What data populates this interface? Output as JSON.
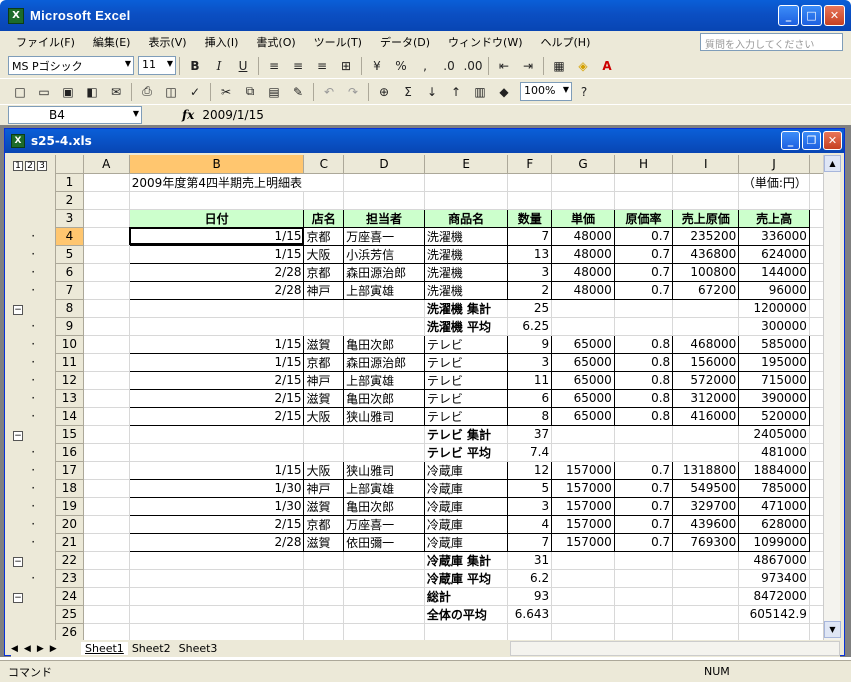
{
  "app": {
    "title": "Microsoft Excel",
    "help_placeholder": "質問を入力してください"
  },
  "menu": [
    "ファイル(F)",
    "編集(E)",
    "表示(V)",
    "挿入(I)",
    "書式(O)",
    "ツール(T)",
    "データ(D)",
    "ウィンドウ(W)",
    "ヘルプ(H)"
  ],
  "toolbar": {
    "font": "MS Pゴシック",
    "size": "11",
    "zoom": "100%"
  },
  "formula": {
    "name": "B4",
    "fx": "fx",
    "value": "2009/1/15"
  },
  "doc": {
    "title": "s25-4.xls"
  },
  "outline_levels": [
    "1",
    "2",
    "3"
  ],
  "columns": [
    "A",
    "B",
    "C",
    "D",
    "E",
    "F",
    "G",
    "H",
    "I",
    "J"
  ],
  "rows": [
    {
      "n": "1",
      "b": "2009年度第4四半期売上明細表",
      "j": "（単価:円）"
    },
    {
      "n": "2"
    },
    {
      "n": "3",
      "hdr": true,
      "b": "日付",
      "c": "店名",
      "d": "担当者",
      "e": "商品名",
      "f": "数量",
      "g": "単価",
      "h": "原価率",
      "i": "売上原価",
      "j": "売上高"
    },
    {
      "n": "4",
      "b": "1/15",
      "c": "京都",
      "d": "万座喜一",
      "e": "洗濯機",
      "f": "7",
      "g": "48000",
      "h": "0.7",
      "i": "235200",
      "j": "336000"
    },
    {
      "n": "5",
      "b": "1/15",
      "c": "大阪",
      "d": "小浜芳信",
      "e": "洗濯機",
      "f": "13",
      "g": "48000",
      "h": "0.7",
      "i": "436800",
      "j": "624000"
    },
    {
      "n": "6",
      "b": "2/28",
      "c": "京都",
      "d": "森田源治郎",
      "e": "洗濯機",
      "f": "3",
      "g": "48000",
      "h": "0.7",
      "i": "100800",
      "j": "144000"
    },
    {
      "n": "7",
      "b": "2/28",
      "c": "神戸",
      "d": "上部寅雄",
      "e": "洗濯機",
      "f": "2",
      "g": "48000",
      "h": "0.7",
      "i": "67200",
      "j": "96000"
    },
    {
      "n": "8",
      "sub": true,
      "e": "洗濯機 集計",
      "f": "25",
      "j": "1200000"
    },
    {
      "n": "9",
      "sub": true,
      "e": "洗濯機 平均",
      "f": "6.25",
      "j": "300000"
    },
    {
      "n": "10",
      "b": "1/15",
      "c": "滋賀",
      "d": "亀田次郎",
      "e": "テレビ",
      "f": "9",
      "g": "65000",
      "h": "0.8",
      "i": "468000",
      "j": "585000"
    },
    {
      "n": "11",
      "b": "1/15",
      "c": "京都",
      "d": "森田源治郎",
      "e": "テレビ",
      "f": "3",
      "g": "65000",
      "h": "0.8",
      "i": "156000",
      "j": "195000"
    },
    {
      "n": "12",
      "b": "2/15",
      "c": "神戸",
      "d": "上部寅雄",
      "e": "テレビ",
      "f": "11",
      "g": "65000",
      "h": "0.8",
      "i": "572000",
      "j": "715000"
    },
    {
      "n": "13",
      "b": "2/15",
      "c": "滋賀",
      "d": "亀田次郎",
      "e": "テレビ",
      "f": "6",
      "g": "65000",
      "h": "0.8",
      "i": "312000",
      "j": "390000"
    },
    {
      "n": "14",
      "b": "2/15",
      "c": "大阪",
      "d": "狭山雅司",
      "e": "テレビ",
      "f": "8",
      "g": "65000",
      "h": "0.8",
      "i": "416000",
      "j": "520000"
    },
    {
      "n": "15",
      "sub": true,
      "e": "テレビ 集計",
      "f": "37",
      "j": "2405000"
    },
    {
      "n": "16",
      "sub": true,
      "e": "テレビ 平均",
      "f": "7.4",
      "j": "481000"
    },
    {
      "n": "17",
      "b": "1/15",
      "c": "大阪",
      "d": "狭山雅司",
      "e": "冷蔵庫",
      "f": "12",
      "g": "157000",
      "h": "0.7",
      "i": "1318800",
      "j": "1884000"
    },
    {
      "n": "18",
      "b": "1/30",
      "c": "神戸",
      "d": "上部寅雄",
      "e": "冷蔵庫",
      "f": "5",
      "g": "157000",
      "h": "0.7",
      "i": "549500",
      "j": "785000"
    },
    {
      "n": "19",
      "b": "1/30",
      "c": "滋賀",
      "d": "亀田次郎",
      "e": "冷蔵庫",
      "f": "3",
      "g": "157000",
      "h": "0.7",
      "i": "329700",
      "j": "471000"
    },
    {
      "n": "20",
      "b": "2/15",
      "c": "京都",
      "d": "万座喜一",
      "e": "冷蔵庫",
      "f": "4",
      "g": "157000",
      "h": "0.7",
      "i": "439600",
      "j": "628000"
    },
    {
      "n": "21",
      "b": "2/28",
      "c": "滋賀",
      "d": "依田彌一",
      "e": "冷蔵庫",
      "f": "7",
      "g": "157000",
      "h": "0.7",
      "i": "769300",
      "j": "1099000"
    },
    {
      "n": "22",
      "sub": true,
      "e": "冷蔵庫 集計",
      "f": "31",
      "j": "4867000"
    },
    {
      "n": "23",
      "sub": true,
      "e": "冷蔵庫 平均",
      "f": "6.2",
      "j": "973400"
    },
    {
      "n": "24",
      "sub": true,
      "e": "総計",
      "f": "93",
      "j": "8472000"
    },
    {
      "n": "25",
      "sub": true,
      "e": "全体の平均",
      "f": "6.643",
      "j": "605142.9"
    },
    {
      "n": "26"
    }
  ],
  "sheets": [
    "Sheet1",
    "Sheet2",
    "Sheet3"
  ],
  "status": {
    "left": "コマンド",
    "num": "NUM"
  }
}
